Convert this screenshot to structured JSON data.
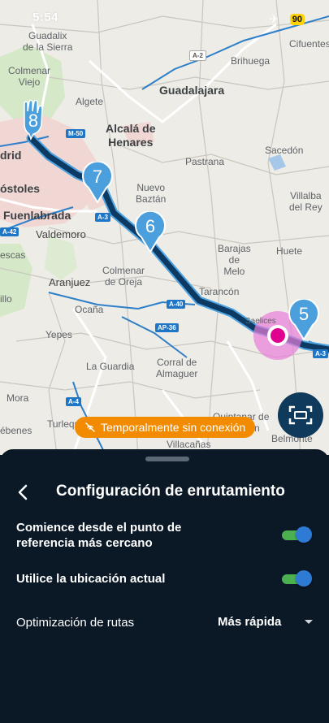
{
  "status_bar": {
    "time": "5:54",
    "battery": "90",
    "airplane_icon": "airplane-icon"
  },
  "map": {
    "labels": {
      "guadalix": "Guadalix\nde la Sierra",
      "colmenar_viejo": "Colmenar\nViejo",
      "algete": "Algete",
      "guadalajara": "Guadalajara",
      "alcala": "Alcalá de\nHenares",
      "madrid": "drid",
      "mostoles": "óstoles",
      "fuenlabrada": "Fuenlabrada",
      "valdemoro": "Valdemoro",
      "nuevo_baztan": "Nuevo\nBaztán",
      "aranjuez": "Aranjuez",
      "colmenar_oreja": "Colmenar\nde Oreja",
      "barajas": "Barajas\nde\nMelo",
      "huete": "Huete",
      "tarancon": "Tarancón",
      "ocana": "Ocaña",
      "yepes": "Yepes",
      "la_guardia": "La Guardia",
      "corral": "Corral de\nAlmaguer",
      "mora": "Mora",
      "turleque": "Turleque",
      "villacanas": "Villacañas",
      "saelices": "Saelices",
      "cifuentes": "Cifuentes",
      "brihuega": "Brihuega",
      "sacedon": "Sacedón",
      "pastrana": "Pastrana",
      "villalba": "Villalba\ndel Rey",
      "belmonte": "Belmonte",
      "quintanar": "Quintanar de\nla Orden",
      "escas": "escas",
      "illo": "illo",
      "ebenes": "ébenes"
    },
    "roads": [
      "A-2",
      "M-50",
      "A-3",
      "A-42",
      "A-40",
      "AP-36",
      "A-4",
      "A-3"
    ],
    "waypoints": [
      "8",
      "7",
      "6",
      "5"
    ],
    "offline_chip": {
      "icon": "no-connection-icon",
      "text": "Temporalmente sin conexión"
    },
    "scan_button_icon": "scan-frame-icon"
  },
  "sheet": {
    "title": "Configuración de enrutamiento",
    "back_icon": "back-chevron-icon",
    "rows": [
      {
        "label": "Comience desde el punto de referencia más cercano",
        "toggle": true
      },
      {
        "label": "Utilice la ubicación actual",
        "toggle": true
      }
    ],
    "optimization": {
      "label": "Optimización de rutas",
      "value": "Más rápida"
    }
  },
  "colors": {
    "route": "#0d3a63",
    "route_edge": "#4fa3e0",
    "pin": "#4b9fdc",
    "toggle_knob": "#2e7bd6",
    "toggle_track": "#4caf50",
    "offline": "#f28b00",
    "sheet_bg": "#0b1826"
  }
}
